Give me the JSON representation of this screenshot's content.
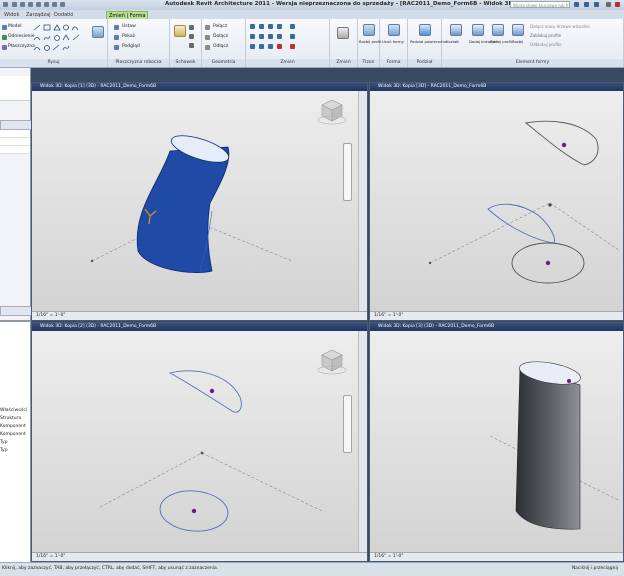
{
  "app": {
    "title": "Autodesk Revit Architecture 2011 - Wersja nieprzeznaczona do sprzedaży - [RAC2011_Demo_Form6B - Widok 3D: ...",
    "search_placeholder": "Wpisz słowo kluczowe lub fraz"
  },
  "tabs": [
    "Widok",
    "Zarządzaj",
    "Dodatki",
    "Zmień | Forma"
  ],
  "ribbon": {
    "panels": [
      {
        "label": "Rysuj",
        "items": [
          "Model",
          "Odniesienie",
          "Płaszczyzna"
        ]
      },
      {
        "label": "Płaszczyzna robocza",
        "items": [
          "Ustaw",
          "Pokaż",
          "Podgląd"
        ]
      },
      {
        "label": "Schowek",
        "items": []
      },
      {
        "label": "Geometria",
        "items": [
          "Połącz",
          "Dołącz",
          "Odłącz"
        ]
      },
      {
        "label": "Zmień",
        "items": []
      },
      {
        "label": "Zmień",
        "items": []
      },
      {
        "label": "Trzon",
        "items": [
          "Rozbij profil"
        ]
      },
      {
        "label": "Forma",
        "items": [
          "Usuń formy"
        ]
      },
      {
        "label": "Podział",
        "items": [
          "Podział powierzchni"
        ]
      },
      {
        "label": "Element formy",
        "items": [
          "Kształt",
          "Dodaj krawędź",
          "Dodaj profil",
          "Rozbij",
          "Dołącz nowy drzewo wizualne",
          "Zablokuj profile",
          "Odblokuj profile"
        ]
      }
    ]
  },
  "left_panel": {
    "items": [
      "Właściwości",
      "Struktura",
      "Komponent",
      "Komponent",
      "Typ",
      "Typ"
    ]
  },
  "viewports": [
    {
      "header": "Widok 3D: Kopia [1] (3D) - RAC2011_Demo_Form6B",
      "footer": "1/16\" = 1'-0\""
    },
    {
      "header": "Widok 3D: Kopia [3D] - RAC2011_Demo_Form6B",
      "footer": "1/16\" = 1'-0\""
    },
    {
      "header": "Widok 3D: Kopia [2] (3D) - RAC2011_Demo_Form6B",
      "footer": "1/16\" = 1'-0\""
    },
    {
      "header": "Widok 3D: Kopia [3] (3D) - RAC2011_Demo_Form6B",
      "footer": "1/16\" = 1'-0\""
    }
  ],
  "status": {
    "message": "Kliknij, aby zaznaczyć, TAB, aby przełączyć, CTRL, aby dodać, SHIFT, aby usunąć z zaznaczenia.",
    "right": "Naciśnij i przeciągnij"
  },
  "colors": {
    "form_blue": "#1f4aa6",
    "sketch_blue": "#5470b8",
    "point_purple": "#6a1b8f",
    "form_gray": "#575a60"
  }
}
